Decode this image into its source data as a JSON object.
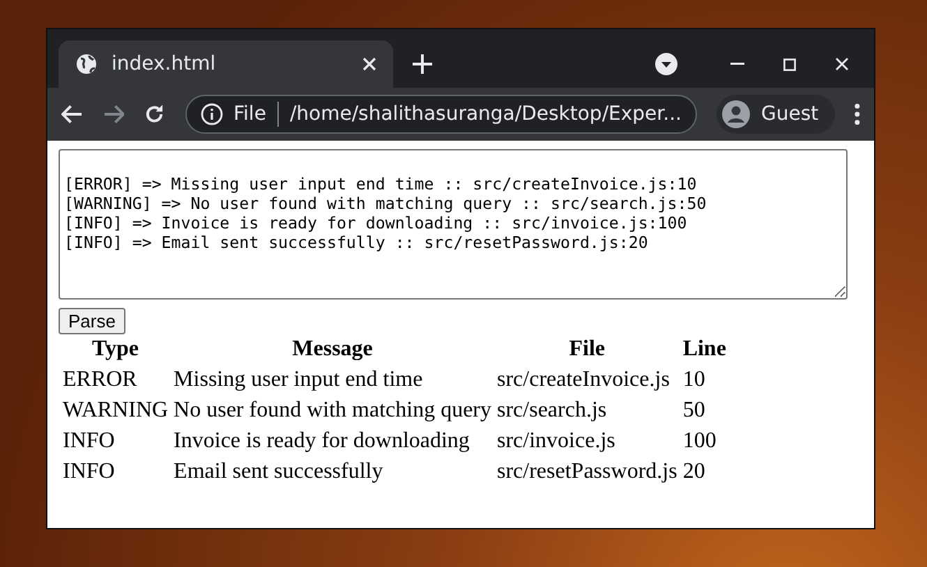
{
  "browser": {
    "tab": {
      "title": "index.html",
      "selected": true
    },
    "address": {
      "scheme": "File",
      "url": "/home/shalithasuranga/Desktop/Exper..."
    },
    "profile": "Guest"
  },
  "page": {
    "log_lines": [
      "[ERROR] => Missing user input end time :: src/createInvoice.js:10",
      "[WARNING] => No user found with matching query :: src/search.js:50",
      "[INFO] => Invoice is ready for downloading :: src/invoice.js:100",
      "[INFO] => Email sent successfully :: src/resetPassword.js:20"
    ],
    "parse_button": "Parse",
    "table": {
      "columns": [
        "Type",
        "Message",
        "File",
        "Line"
      ],
      "rows": [
        [
          "ERROR",
          "Missing user input end time",
          "src/createInvoice.js",
          "10"
        ],
        [
          "WARNING",
          "No user found with matching query",
          "src/search.js",
          "50"
        ],
        [
          "INFO",
          "Invoice is ready for downloading",
          "src/invoice.js",
          "100"
        ],
        [
          "INFO",
          "Email sent successfully",
          "src/resetPassword.js",
          "20"
        ]
      ]
    }
  }
}
